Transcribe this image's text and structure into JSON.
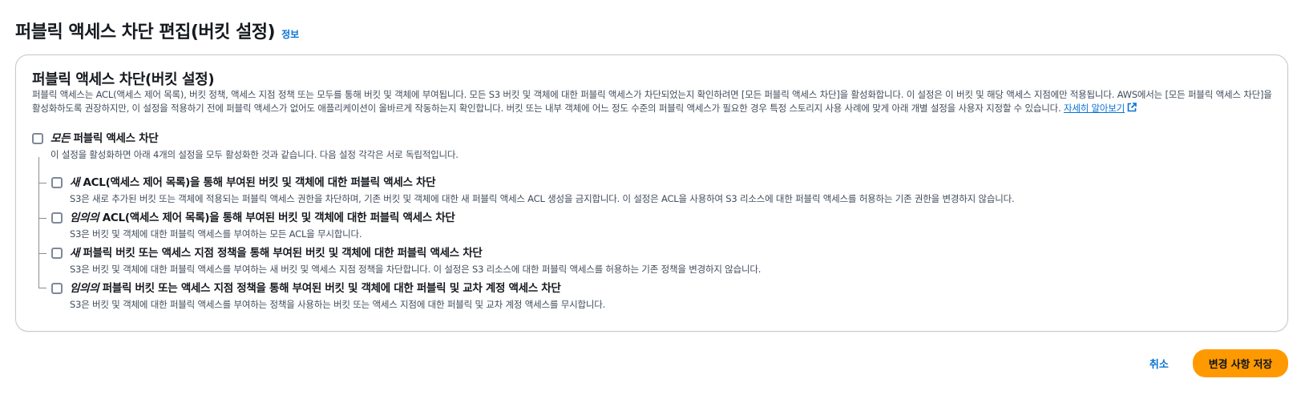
{
  "header": {
    "title": "퍼블릭 액세스 차단 편집(버킷 설정)",
    "info_label": "정보"
  },
  "panel": {
    "title": "퍼블릭 액세스 차단(버킷 설정)",
    "description": "퍼블릭 액세스는 ACL(액세스 제어 목록), 버킷 정책, 액세스 지점 정책 또는 모두를 통해 버킷 및 객체에 부여됩니다. 모든 S3 버킷 및 객체에 대한 퍼블릭 액세스가 차단되었는지 확인하려면 [모든 퍼블릭 액세스 차단]을 활성화합니다. 이 설정은 이 버킷 및 해당 액세스 지점에만 적용됩니다. AWS에서는 [모든 퍼블릭 액세스 차단]을 활성화하도록 권장하지만, 이 설정을 적용하기 전에 퍼블릭 액세스가 없어도 애플리케이션이 올바르게 작동하는지 확인합니다. 버킷 또는 내부 객체에 어느 정도 수준의 퍼블릭 액세스가 필요한 경우 특정 스토리지 사용 사례에 맞게 아래 개별 설정을 사용자 지정할 수 있습니다.",
    "learn_more_label": "자세히 알아보기"
  },
  "options": {
    "all": {
      "label_emph": "모든",
      "label_rest": " 퍼블릭 액세스 차단",
      "description": "이 설정을 활성화하면 아래 4개의 설정을 모두 활성화한 것과 같습니다. 다음 설정 각각은 서로 독립적입니다."
    },
    "sub": [
      {
        "label_emph": "새",
        "label_rest": " ACL(액세스 제어 목록)을 통해 부여된 버킷 및 객체에 대한 퍼블릭 액세스 차단",
        "description": "S3은 새로 추가된 버킷 또는 객체에 적용되는 퍼블릭 액세스 권한을 차단하며, 기존 버킷 및 객체에 대한 새 퍼블릭 액세스 ACL 생성을 금지합니다. 이 설정은 ACL을 사용하여 S3 리소스에 대한 퍼블릭 액세스를 허용하는 기존 권한을 변경하지 않습니다."
      },
      {
        "label_emph": "임의의",
        "label_rest": " ACL(액세스 제어 목록)을 통해 부여된 버킷 및 객체에 대한 퍼블릭 액세스 차단",
        "description": "S3은 버킷 및 객체에 대한 퍼블릭 액세스를 부여하는 모든 ACL을 무시합니다."
      },
      {
        "label_emph": "새",
        "label_rest": " 퍼블릭 버킷 또는 액세스 지점 정책을 통해 부여된 버킷 및 객체에 대한 퍼블릭 액세스 차단",
        "description": "S3은 버킷 및 객체에 대한 퍼블릭 액세스를 부여하는 새 버킷 및 액세스 지점 정책을 차단합니다. 이 설정은 S3 리소스에 대한 퍼블릭 액세스를 허용하는 기존 정책을 변경하지 않습니다."
      },
      {
        "label_emph": "임의의",
        "label_rest": " 퍼블릭 버킷 또는 액세스 지점 정책을 통해 부여된 버킷 및 객체에 대한 퍼블릭 및 교차 계정 액세스 차단",
        "description": "S3은 버킷 및 객체에 대한 퍼블릭 액세스를 부여하는 정책을 사용하는 버킷 또는 액세스 지점에 대한 퍼블릭 및 교차 계정 액세스를 무시합니다."
      }
    ]
  },
  "footer": {
    "cancel_label": "취소",
    "save_label": "변경 사항 저장"
  },
  "colors": {
    "link": "#0972d3",
    "primary_button": "#ff9900",
    "border": "#c6c6cd"
  },
  "icons": {
    "external_link": "external-link-icon"
  }
}
